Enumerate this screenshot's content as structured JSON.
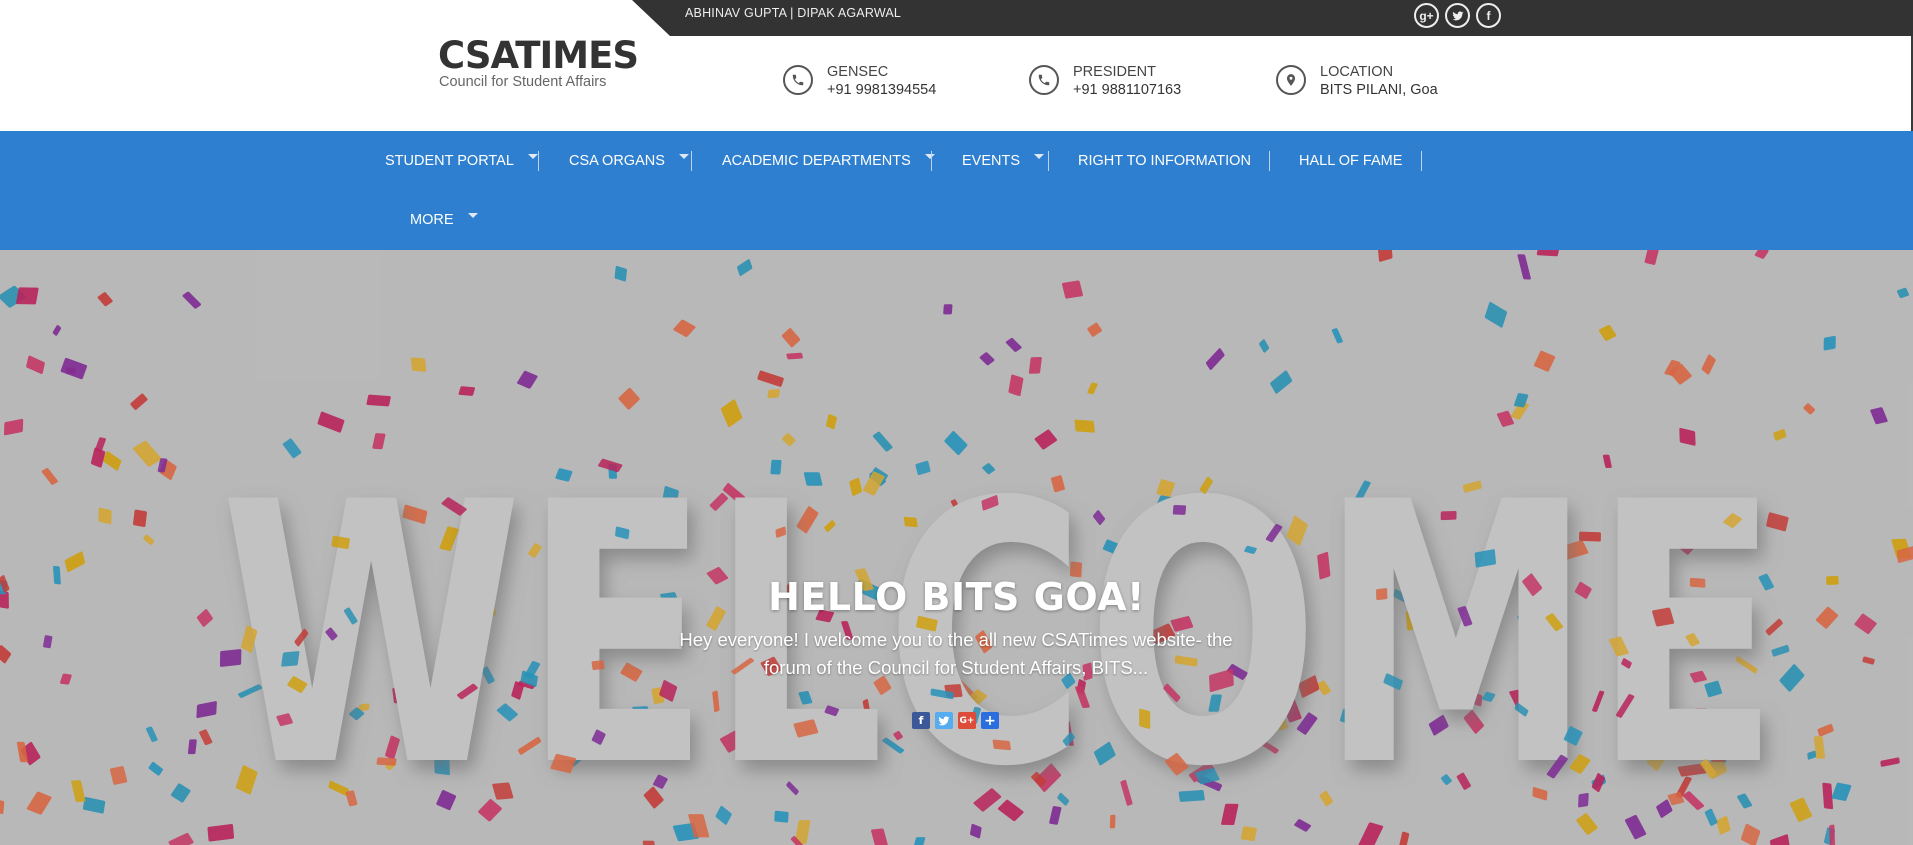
{
  "topbar": {
    "names": "ABHINAV GUPTA | DIPAK AGARWAL",
    "social": [
      {
        "icon": "google-plus-icon",
        "glyph": "g+"
      },
      {
        "icon": "twitter-icon",
        "glyph": ""
      },
      {
        "icon": "facebook-icon",
        "glyph": "f"
      }
    ]
  },
  "brand": {
    "title": "CSATIMES",
    "subtitle": "Council for Student Affairs"
  },
  "contacts": [
    {
      "label": "GENSEC",
      "value": "+91 9981394554",
      "icon": "phone-icon"
    },
    {
      "label": "PRESIDENT",
      "value": "+91 9881107163",
      "icon": "phone-icon"
    },
    {
      "label": "LOCATION",
      "value": "BITS PILANI, Goa",
      "icon": "location-pin-icon"
    }
  ],
  "nav": {
    "items": [
      {
        "label": "STUDENT PORTAL",
        "has_dropdown": true
      },
      {
        "label": "CSA ORGANS",
        "has_dropdown": true
      },
      {
        "label": "ACADEMIC DEPARTMENTS",
        "has_dropdown": true
      },
      {
        "label": "EVENTS",
        "has_dropdown": true
      },
      {
        "label": "RIGHT TO INFORMATION",
        "has_dropdown": false
      },
      {
        "label": "HALL OF FAME",
        "has_dropdown": false
      },
      {
        "label": "MORE",
        "has_dropdown": true
      }
    ]
  },
  "hero": {
    "title": "HELLO BITS GOA!",
    "text": "Hey everyone! I welcome you to the all new CSATimes website- the forum of the Council for Student Affairs, BITS...",
    "background_word": "WELCOME",
    "share": [
      {
        "icon": "facebook-share-icon",
        "glyph": "f",
        "color": "#3b5998"
      },
      {
        "icon": "twitter-share-icon",
        "glyph": "t",
        "color": "#55acee"
      },
      {
        "icon": "google-plus-share-icon",
        "glyph": "G+",
        "color": "#dd4b39"
      },
      {
        "icon": "addthis-share-icon",
        "glyph": "+",
        "color": "#2a6ee0"
      }
    ]
  },
  "colors": {
    "nav_blue": "#2e7fcf",
    "topbar_dark": "#333333"
  }
}
